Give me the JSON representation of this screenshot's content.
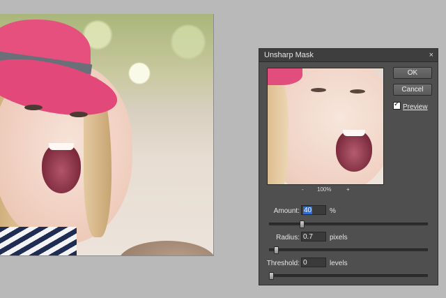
{
  "dialog": {
    "title": "Unsharp Mask",
    "close_glyph": "×",
    "ok_label": "OK",
    "cancel_label": "Cancel",
    "preview_label": "Preview",
    "preview_checked": true,
    "zoom": {
      "minus": "-",
      "value": "100%",
      "plus": "+"
    },
    "amount": {
      "label": "Amount:",
      "value": "40",
      "unit": "%",
      "slider_fraction": 0.2
    },
    "radius": {
      "label": "Radius:",
      "value": "0.7",
      "unit": "pixels",
      "slider_fraction": 0.03
    },
    "threshold": {
      "label": "Threshold:",
      "value": "0",
      "unit": "levels",
      "slider_fraction": 0.0
    }
  },
  "icons": {
    "close": "close-icon",
    "checkmark": "checkmark-icon"
  },
  "colors": {
    "dialog_bg": "#4f4f4f",
    "workspace_bg": "#b9b9b9",
    "selection": "#2f6cd3"
  }
}
